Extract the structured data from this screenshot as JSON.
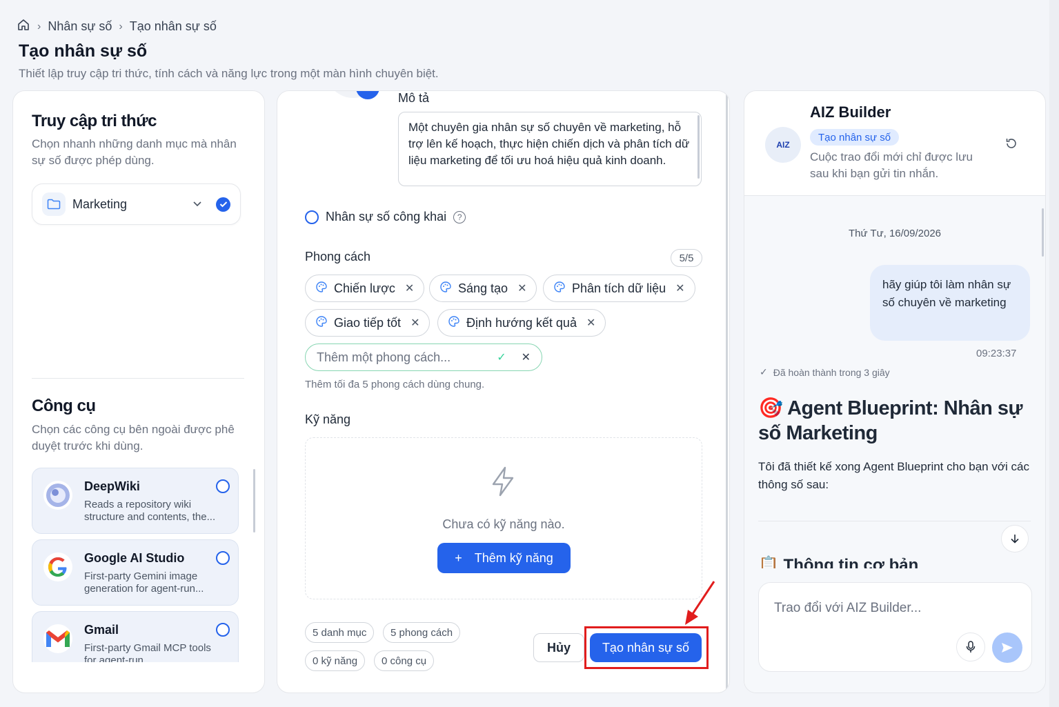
{
  "breadcrumb": {
    "item1": "Nhân sự số",
    "item2": "Tạo nhân sự số"
  },
  "page": {
    "title": "Tạo nhân sự số",
    "subtitle": "Thiết lập truy cập tri thức, tính cách và năng lực trong một màn hình chuyên biệt."
  },
  "knowledge": {
    "title": "Truy cập tri thức",
    "desc": "Chọn nhanh những danh mục mà nhân sự số được phép dùng.",
    "item_label": "Marketing"
  },
  "tools": {
    "title": "Công cụ",
    "desc": "Chọn các công cụ bên ngoài được phê duyệt trước khi dùng.",
    "items": [
      {
        "name": "DeepWiki",
        "desc": "Reads a repository wiki structure and contents, the..."
      },
      {
        "name": "Google AI Studio",
        "desc": "First-party Gemini image generation for agent-run..."
      },
      {
        "name": "Gmail",
        "desc": "First-party Gmail MCP tools for agent-run..."
      }
    ]
  },
  "form": {
    "desc_label": "Mô tả",
    "desc_value": "Một chuyên gia nhân sự số chuyên về marketing, hỗ trợ lên kế hoạch, thực hiện chiến dịch và phân tích dữ liệu marketing để tối ưu hoá hiệu quả kinh doanh.",
    "public_label": "Nhân sự số công khai",
    "style_label": "Phong cách",
    "style_count": "5/5",
    "styles": [
      "Chiến lược",
      "Sáng tạo",
      "Phân tích dữ liệu",
      "Giao tiếp tốt",
      "Định hướng kết quả"
    ],
    "add_style_placeholder": "Thêm một phong cách...",
    "style_hint": "Thêm tối đa 5 phong cách dùng chung.",
    "skills_label": "Kỹ năng",
    "skills_empty": "Chưa có kỹ năng nào.",
    "add_skill": "Thêm kỹ năng",
    "stats": [
      "5 danh mục",
      "5 phong cách",
      "0 kỹ năng",
      "0 công cụ"
    ],
    "cancel": "Hủy",
    "create": "Tạo nhân sự số"
  },
  "chat": {
    "logo_text": "AIZ",
    "title": "AIZ Builder",
    "badge": "Tạo nhân sự số",
    "note": "Cuộc trao đổi mới chỉ được lưu sau khi bạn gửi tin nhắn.",
    "date": "Thứ Tư, 16/09/2026",
    "user_msg": "hãy giúp tôi làm nhân sự số chuyên về marketing",
    "time": "09:23:37",
    "done": "Đã hoàn thành trong 3 giây",
    "bp_title": "🎯 Agent Blueprint: Nhân sự số Marketing",
    "bp_text": "Tôi đã thiết kế xong Agent Blueprint cho bạn với các thông số sau:",
    "section_frag": "📋 Thông tin cơ bản",
    "composer_placeholder": "Trao đổi với AIZ Builder..."
  },
  "colors": {
    "accent": "#2563eb",
    "highlight": "#e11d1d"
  }
}
